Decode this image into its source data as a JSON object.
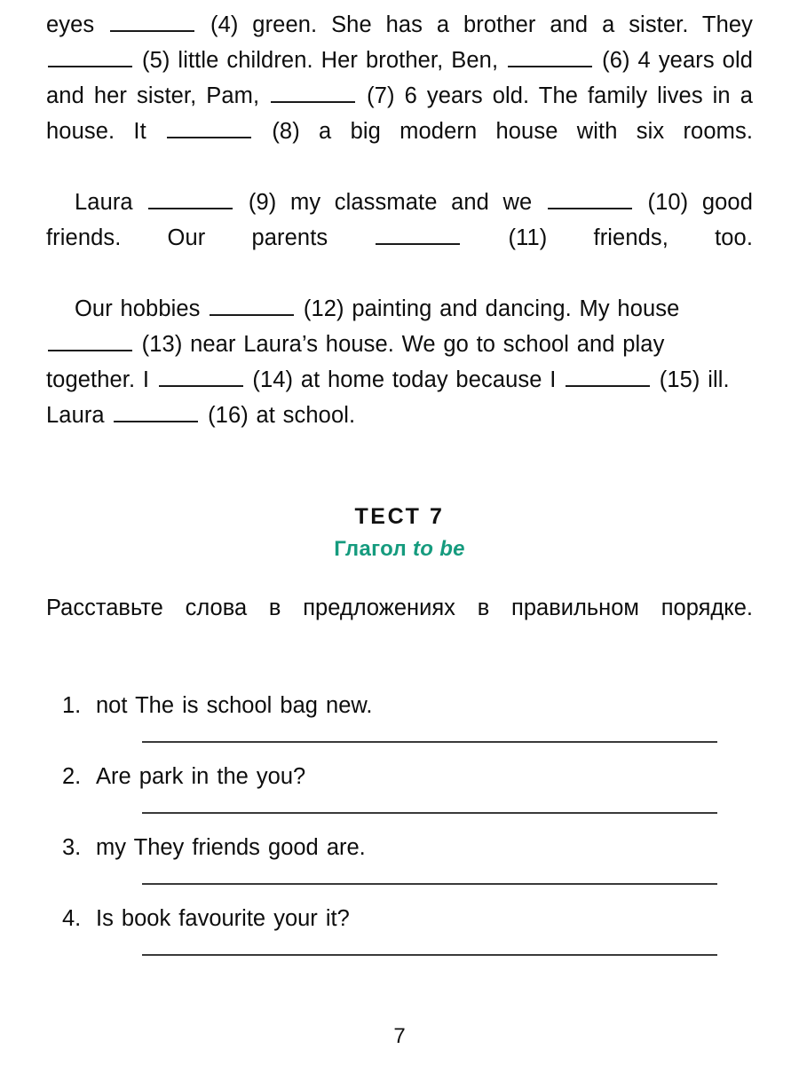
{
  "document": {
    "page_number": "7"
  },
  "cloze": {
    "paragraphs": [
      {
        "id": "p1",
        "segments": [
          {
            "type": "text",
            "value": "eyes "
          },
          {
            "type": "blank"
          },
          {
            "type": "text",
            "value": " (4) green. She has a brother and a sister. They "
          },
          {
            "type": "blank"
          },
          {
            "type": "text",
            "value": " (5) little children. Her brother, Ben, "
          },
          {
            "type": "blank"
          },
          {
            "type": "text",
            "value": " (6) 4 years old and her sister, Pam, "
          },
          {
            "type": "blank"
          },
          {
            "type": "text",
            "value": " (7) 6 years old. The family lives in a house. It "
          },
          {
            "type": "blank"
          },
          {
            "type": "text",
            "value": " (8) a big modern house with six rooms."
          }
        ]
      },
      {
        "id": "p2",
        "indent": true,
        "segments": [
          {
            "type": "text",
            "value": "Laura "
          },
          {
            "type": "blank"
          },
          {
            "type": "text",
            "value": " (9) my classmate and we "
          },
          {
            "type": "blank"
          },
          {
            "type": "text",
            "value": " (10) good friends. Our parents "
          },
          {
            "type": "blank"
          },
          {
            "type": "text",
            "value": " (11) friends, too."
          }
        ]
      },
      {
        "id": "p3",
        "indent": true,
        "segments": [
          {
            "type": "text",
            "value": "Our hobbies "
          },
          {
            "type": "blank"
          },
          {
            "type": "text",
            "value": " (12) painting and dancing. My house "
          },
          {
            "type": "blank"
          },
          {
            "type": "text",
            "value": " (13) near Laura’s house. We go to school and play together. I "
          },
          {
            "type": "blank"
          },
          {
            "type": "text",
            "value": " (14) at home today because I "
          },
          {
            "type": "blank"
          },
          {
            "type": "text",
            "value": " (15) ill. Laura "
          },
          {
            "type": "blank"
          },
          {
            "type": "text",
            "value": " (16) at school."
          }
        ]
      }
    ]
  },
  "test": {
    "title": "ТЕСТ 7",
    "subtitle_ru": "Глагол ",
    "subtitle_lat": "to be",
    "subtitle_color": "#159b7e",
    "instruction": "Расставьте слова в предложениях в правильном порядке.",
    "tasks": [
      {
        "num": "1.",
        "text": "not The is school bag new."
      },
      {
        "num": "2.",
        "text": "Are park in the you?"
      },
      {
        "num": "3.",
        "text": "my They friends good are."
      },
      {
        "num": "4.",
        "text": "Is book favourite your it?"
      }
    ]
  }
}
